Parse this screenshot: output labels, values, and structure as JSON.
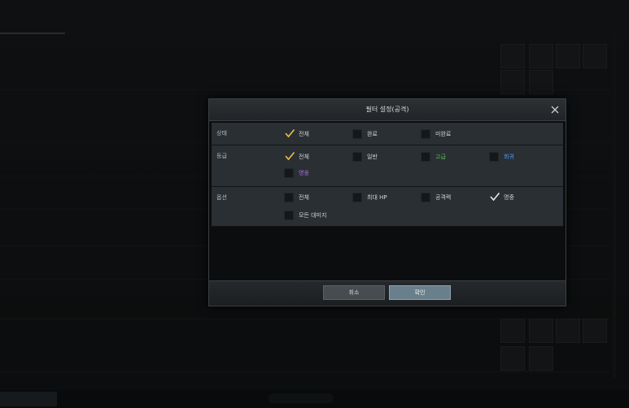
{
  "dialog": {
    "title": "필터 설정(공격)",
    "close_icon": "close-icon",
    "rows": [
      {
        "label": "상태",
        "options": [
          {
            "label": "전체",
            "checked": true,
            "color": "#d2d5d7"
          },
          {
            "label": "완료",
            "checked": false,
            "color": "#d2d5d7"
          },
          {
            "label": "미완료",
            "checked": false,
            "color": "#d2d5d7"
          }
        ]
      },
      {
        "label": "등급",
        "options": [
          {
            "label": "전체",
            "checked": true,
            "color": "#d2d5d7"
          },
          {
            "label": "일반",
            "checked": false,
            "color": "#d2d5d7"
          },
          {
            "label": "고급",
            "checked": false,
            "color": "#5cb85c"
          },
          {
            "label": "희귀",
            "checked": false,
            "color": "#4da3ff"
          },
          {
            "label": "영웅",
            "checked": false,
            "color": "#b86cf0"
          }
        ]
      },
      {
        "label": "옵션",
        "options": [
          {
            "label": "전체",
            "checked": false,
            "color": "#d2d5d7"
          },
          {
            "label": "최대 HP",
            "checked": false,
            "color": "#d2d5d7"
          },
          {
            "label": "공격력",
            "checked": false,
            "color": "#d2d5d7"
          },
          {
            "label": "명중",
            "checked": true,
            "color": "#d2d5d7"
          },
          {
            "label": "모든 대미지",
            "checked": false,
            "color": "#d2d5d7"
          }
        ]
      }
    ],
    "cancel_label": "취소",
    "ok_label": "확인"
  },
  "colors": {
    "check_yellow": "#e8c14a",
    "check_white": "#e6e8ea",
    "accent_button": "#6a7f8c"
  }
}
